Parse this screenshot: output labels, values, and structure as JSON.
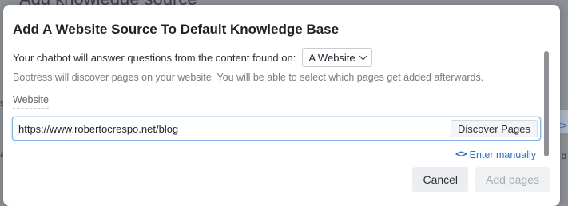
{
  "background": {
    "heading_fragment": "Add knowledge source",
    "right_glyph": "<>",
    "right_letter": "b",
    "left_mark": "s",
    "left_mark2": "a"
  },
  "dialog": {
    "title": "Add A Website Source To Default Knowledge Base",
    "intro_text": "Your chatbot will answer questions from the content found on:",
    "source_select": {
      "selected": "A Website",
      "icon": "chevron-down-icon"
    },
    "helper_text": "Boptress will discover pages on your website. You will be able to select which pages get added afterwards.",
    "website_field": {
      "label": "Website",
      "value": "https://www.robertocrespo.net/blog",
      "placeholder": "",
      "discover_button_label": "Discover Pages"
    },
    "enter_manually": {
      "label": "Enter manually",
      "icon": "code-icon"
    },
    "footer": {
      "cancel_label": "Cancel",
      "add_pages_label": "Add pages",
      "add_pages_disabled": true
    },
    "colors": {
      "link": "#2f73c0",
      "input_focus_border": "#7fb2e5",
      "title": "#1f2329",
      "helper": "#777b82"
    }
  }
}
